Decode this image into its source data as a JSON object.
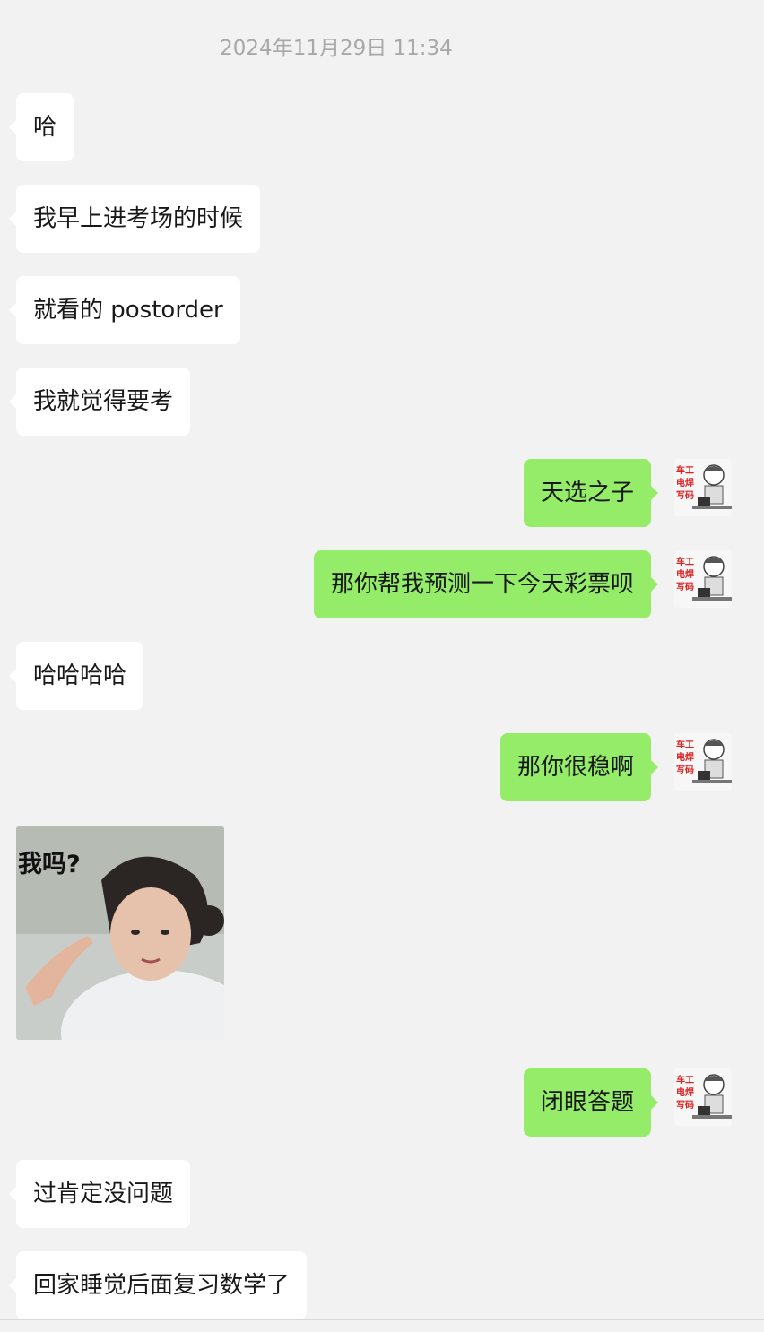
{
  "chat": {
    "timestamp": "2024年11月29日 11:34",
    "messages": [
      {
        "side": "in",
        "text": "哈"
      },
      {
        "side": "in",
        "text": "我早上进考场的时候"
      },
      {
        "side": "in",
        "text": "就看的 postorder"
      },
      {
        "side": "in",
        "text": "我就觉得要考"
      },
      {
        "side": "out",
        "text": "天选之子"
      },
      {
        "side": "out",
        "text": "那你帮我预测一下今天彩票呗"
      },
      {
        "side": "in",
        "text": "哈哈哈哈"
      },
      {
        "side": "out",
        "text": "那你很稳啊"
      },
      {
        "side": "in",
        "type": "sticker",
        "caption": "我吗?"
      },
      {
        "side": "out",
        "text": "闭眼答题"
      },
      {
        "side": "in",
        "text": "过肯定没问题"
      },
      {
        "side": "in",
        "text": "回家睡觉后面复习数学了"
      }
    ]
  },
  "avatar": {
    "sign_lines": [
      "车工",
      "电焊",
      "写码"
    ]
  },
  "colors": {
    "background": "#f2f2f2",
    "incoming_bubble": "#ffffff",
    "outgoing_bubble": "#95ec69",
    "timestamp_text": "#a8a8a8"
  }
}
